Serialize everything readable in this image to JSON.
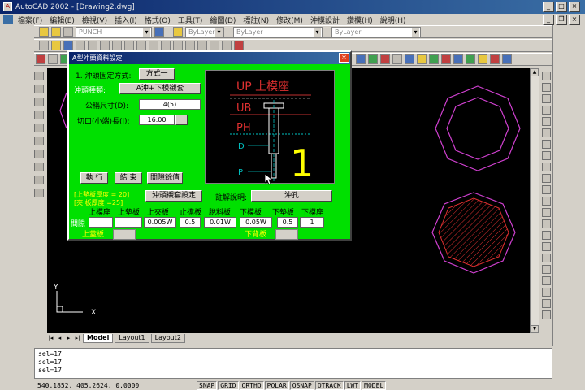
{
  "window": {
    "title": "AutoCAD 2002 - [Drawing2.dwg]"
  },
  "menubar": {
    "items": [
      "檔案(F)",
      "編輯(E)",
      "檢視(V)",
      "插入(I)",
      "格式(O)",
      "工具(T)",
      "繪圖(D)",
      "標註(N)",
      "修改(M)",
      "沖模設計",
      "鑽模(H)",
      "說明(H)"
    ]
  },
  "toolbar": {
    "layer_combo": "PUNCH",
    "color_combo": "ByLayer",
    "linetype_combo": "ByLayer",
    "lineweight_combo": "ByLayer"
  },
  "dialog": {
    "title": "A型沖頭資料設定",
    "fix_method_label": "1. 沖頭固定方式:",
    "fix_method_value": "方式一",
    "punch_type_label": "沖頭種類:",
    "punch_type_value": "A沖+下模襯套",
    "nominal_size_label": "公稱尺寸(D):",
    "nominal_size_value": "4(5)",
    "cut_length_label": "切口(小端)長(l):",
    "cut_length_value": "16.00",
    "execute_btn": "執 行",
    "end_btn": "結 束",
    "clearance_btn": "間隙餘值",
    "plate_thk_1": "[上墊板厚度 = 20]",
    "plate_thk_2": "[夾 板厚度 =25]",
    "bushing_btn": "沖頭襯套設定",
    "note_label": "註解說明:",
    "note_value": "沖孔",
    "col_headers": [
      "上模座",
      "上墊板",
      "上夾板",
      "止擋板",
      "脫料板",
      "下模板",
      "下墊板",
      "下模座"
    ],
    "gap_label": "間隙",
    "gap_values": [
      "",
      "",
      "0.005W",
      "0.5",
      "0.01W",
      "0.05W",
      "0.5",
      "1"
    ],
    "upper_cover_label": "上蓋板",
    "lower_back_label": "下背板",
    "preview": {
      "up_label": "UP 上模座",
      "ub_label": "UB",
      "ph_label": "PH",
      "d_label": "D",
      "p_label": "P",
      "big_num": "1"
    }
  },
  "tabs": [
    "Model",
    "Layout1",
    "Layout2"
  ],
  "ucs": {
    "y": "Y",
    "x": "X"
  },
  "command_lines": [
    "sel=17",
    "sel=17",
    "sel=17"
  ],
  "status": {
    "coords": "540.1852, 405.2624, 0.0000",
    "buttons": [
      "SNAP",
      "GRID",
      "ORTHO",
      "POLAR",
      "OSNAP",
      "OTRACK",
      "LWT",
      "MODEL"
    ]
  }
}
